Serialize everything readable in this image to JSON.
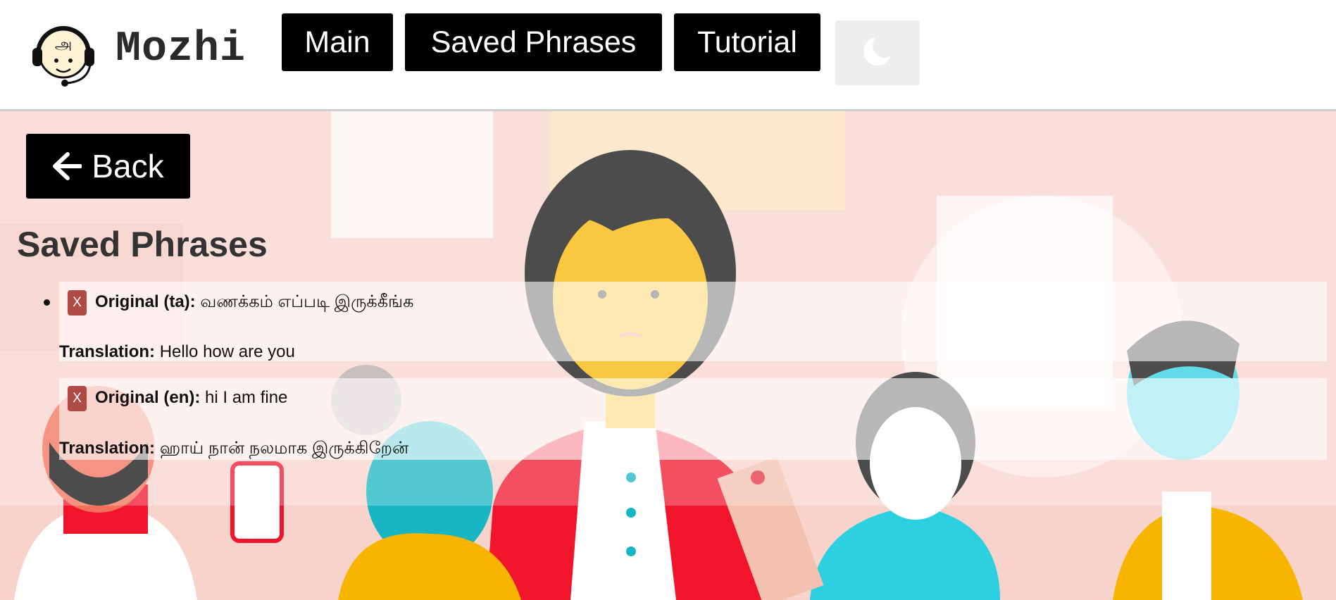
{
  "brand": {
    "name": "Mozhi",
    "logo_glyph": "அ"
  },
  "nav": {
    "main_label": "Main",
    "saved_label": "Saved Phrases",
    "tutorial_label": "Tutorial",
    "theme_icon": "moon-icon"
  },
  "back_button": {
    "label": "Back",
    "icon": "arrow-left-icon"
  },
  "page_title": "Saved Phrases",
  "phrases": [
    {
      "delete_label": "X",
      "original_label": "Original (ta):",
      "original_text": "வணக்கம் எப்படி இருக்கீங்க",
      "translation_label": "Translation:",
      "translation_text": "Hello how are you"
    },
    {
      "delete_label": "X",
      "original_label": "Original (en):",
      "original_text": "hi I am fine",
      "translation_label": "Translation:",
      "translation_text": "ஹாய் நான் நலமாக இருக்கிறேன்"
    }
  ],
  "colors": {
    "nav_button": "#000000",
    "delete_button": "#b04a44",
    "background_tint": "#f7d3cc"
  }
}
